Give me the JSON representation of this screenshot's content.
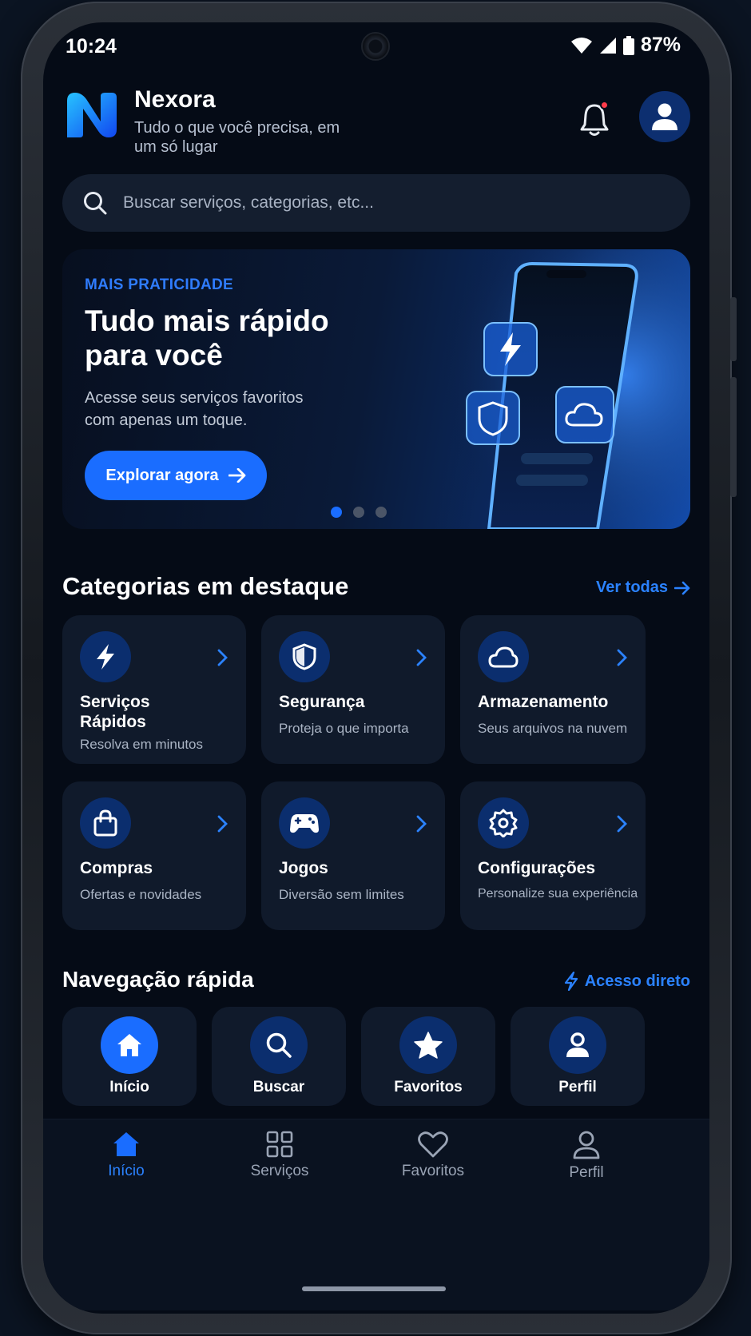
{
  "status_bar": {
    "time": "10:24",
    "battery": "87%"
  },
  "header": {
    "brand_name": "Nexora",
    "tagline": "Tudo o que você precisa, em um só lugar"
  },
  "search": {
    "placeholder": "Buscar serviços, categorias, etc..."
  },
  "banner": {
    "eyebrow": "MAIS PRATICIDADE",
    "title": "Tudo mais rápido para você",
    "subtitle": "Acesse seus serviços favoritos com apenas um toque.",
    "cta": "Explorar agora",
    "active_slide": 1,
    "slide_count": 3
  },
  "categories": {
    "title": "Categorias em destaque",
    "link": "Ver todas",
    "items": [
      {
        "name": "Serviços Rápidos",
        "desc": "Resolva em minutos",
        "icon": "bolt-icon"
      },
      {
        "name": "Segurança",
        "desc": "Proteja o que importa",
        "icon": "shield-icon"
      },
      {
        "name": "Armazenamento",
        "desc": "Seus arquivos na nuvem",
        "icon": "cloud-icon"
      },
      {
        "name": "Compras",
        "desc": "Ofertas e novidades",
        "icon": "shopping-bag-icon"
      },
      {
        "name": "Jogos",
        "desc": "Diversão sem limites",
        "icon": "gamepad-icon"
      },
      {
        "name": "Configurações",
        "desc": "Personalize sua experiência",
        "icon": "gear-icon"
      }
    ]
  },
  "quick_nav": {
    "title": "Navegação rápida",
    "link": "Acesso direto",
    "items": [
      {
        "label": "Início",
        "icon": "home-icon"
      },
      {
        "label": "Buscar",
        "icon": "search-icon"
      },
      {
        "label": "Favoritos",
        "icon": "star-icon"
      },
      {
        "label": "Perfil",
        "icon": "user-icon"
      }
    ]
  },
  "bottom_nav": {
    "items": [
      {
        "label": "Início",
        "icon": "home-icon",
        "active": true
      },
      {
        "label": "Serviços",
        "icon": "grid-icon",
        "active": false
      },
      {
        "label": "Favoritos",
        "icon": "heart-icon",
        "active": false
      },
      {
        "label": "Perfil",
        "icon": "user-icon",
        "active": false
      }
    ]
  },
  "colors": {
    "accent": "#1a6dff",
    "background": "#050b16",
    "card": "#101a2b",
    "icon_circle": "#0b2e6e",
    "notification": "#ff3b4a"
  }
}
